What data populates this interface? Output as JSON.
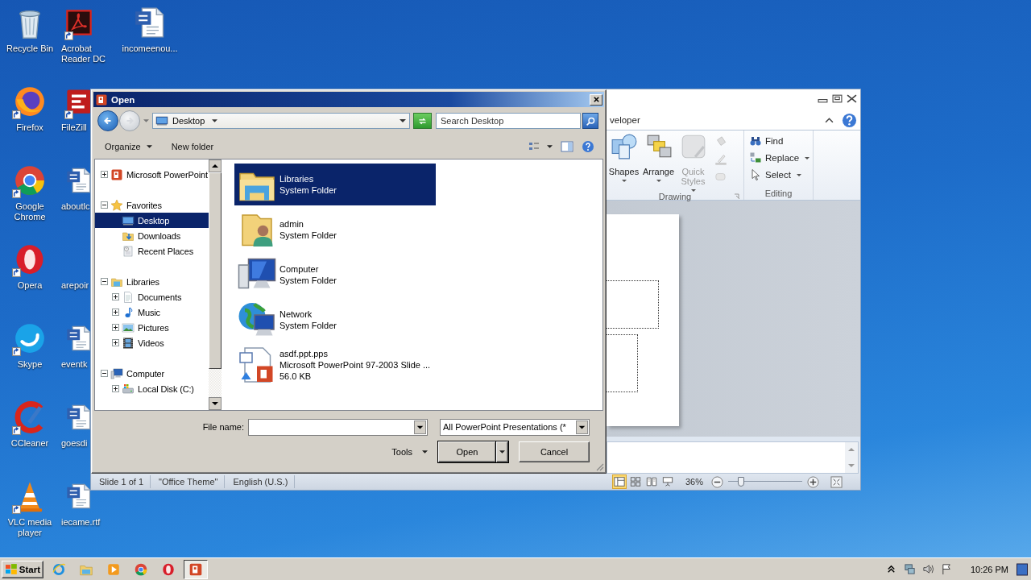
{
  "desktop": {
    "columns": [
      [
        {
          "label": "Recycle Bin",
          "kind": "recycle",
          "shortcut": false
        },
        {
          "label": "Firefox",
          "kind": "firefox",
          "shortcut": true
        },
        {
          "label": "Google Chrome",
          "kind": "chrome",
          "shortcut": true
        },
        {
          "label": "Opera",
          "kind": "opera",
          "shortcut": true
        },
        {
          "label": "Skype",
          "kind": "skype",
          "shortcut": true
        },
        {
          "label": "CCleaner",
          "kind": "ccleaner",
          "shortcut": true
        },
        {
          "label": "VLC media player",
          "kind": "vlc",
          "shortcut": true
        }
      ],
      [
        {
          "label": "Acrobat Reader DC",
          "kind": "acrobat",
          "shortcut": true
        },
        {
          "label": "FileZill",
          "kind": "filezilla",
          "shortcut": true
        },
        {
          "label": "aboutlc",
          "kind": "word",
          "shortcut": false
        },
        {
          "label": "arepoir",
          "kind": "blank",
          "shortcut": false
        },
        {
          "label": "eventk",
          "kind": "word",
          "shortcut": false
        },
        {
          "label": "goesdi",
          "kind": "word",
          "shortcut": false
        },
        {
          "label": "iecame.rtf",
          "kind": "word",
          "shortcut": false
        }
      ],
      [
        {
          "label": "incomeenou...",
          "kind": "word",
          "shortcut": false
        }
      ]
    ]
  },
  "powerpoint": {
    "ribbon_tab": "veloper",
    "drawing": {
      "label": "Drawing",
      "buttons": [
        {
          "label": "Shapes",
          "kind": "shapes",
          "disabled": false
        },
        {
          "label": "Arrange",
          "kind": "arrange",
          "disabled": false
        },
        {
          "label": "Quick Styles",
          "kind": "styles",
          "disabled": true
        }
      ]
    },
    "editing": {
      "label": "Editing",
      "items": [
        {
          "label": "Find",
          "kind": "find",
          "dropdown": false
        },
        {
          "label": "Replace",
          "kind": "replace",
          "dropdown": true
        },
        {
          "label": "Select",
          "kind": "select",
          "dropdown": true
        }
      ]
    },
    "status_bar": {
      "items": [
        "Slide 1 of 1",
        "\"Office Theme\"",
        "English (U.S.)"
      ],
      "views": [
        {
          "kind": "normal",
          "selected": true
        },
        {
          "kind": "sorter",
          "selected": false
        },
        {
          "kind": "reading",
          "selected": false
        },
        {
          "kind": "slideshow",
          "selected": false
        }
      ],
      "zoom": "36%",
      "zoom_slider": {
        "level": 0.17
      }
    }
  },
  "dialog": {
    "title": "Open",
    "address": "Desktop",
    "search": {
      "placeholder": "Search Desktop"
    },
    "organize": "Organize",
    "new_folder": "New folder",
    "tree": [
      {
        "label": "Microsoft PowerPoint",
        "kind": "ppt",
        "expanded": false,
        "selected": false
      },
      {
        "label": "Favorites",
        "kind": "star",
        "expanded": true,
        "selected": false,
        "children": [
          {
            "label": "Desktop",
            "kind": "desktop",
            "selected": true
          },
          {
            "label": "Downloads",
            "kind": "downloads",
            "selected": false
          },
          {
            "label": "Recent Places",
            "kind": "recent",
            "selected": false
          }
        ]
      },
      {
        "label": "Libraries",
        "kind": "libraries",
        "expanded": true,
        "selected": false,
        "children": [
          {
            "label": "Documents",
            "kind": "documents",
            "expanded": false,
            "selected": false
          },
          {
            "label": "Music",
            "kind": "music",
            "expanded": false,
            "selected": false
          },
          {
            "label": "Pictures",
            "kind": "pictures",
            "expanded": false,
            "selected": false
          },
          {
            "label": "Videos",
            "kind": "videos",
            "expanded": false,
            "selected": false
          }
        ]
      },
      {
        "label": "Computer",
        "kind": "computer",
        "expanded": true,
        "selected": false,
        "children": [
          {
            "label": "Local Disk (C:)",
            "kind": "disk",
            "expanded": false,
            "selected": false
          }
        ]
      }
    ],
    "files": [
      {
        "name": "Libraries",
        "details": [
          "System Folder"
        ],
        "kind": "libfolder",
        "selected": true
      },
      {
        "name": "admin",
        "details": [
          "System Folder"
        ],
        "kind": "admin",
        "selected": false
      },
      {
        "name": "Computer",
        "details": [
          "System Folder"
        ],
        "kind": "bigcomputer",
        "selected": false
      },
      {
        "name": "Network",
        "details": [
          "System Folder"
        ],
        "kind": "network",
        "selected": false
      },
      {
        "name": "asdf.ppt.pps",
        "details": [
          "Microsoft PowerPoint 97-2003 Slide ...",
          "56.0 KB"
        ],
        "kind": "pps",
        "selected": false
      }
    ],
    "file_name_label": "File name:",
    "filter": "All PowerPoint Presentations (*",
    "tools": "Tools",
    "open": "Open",
    "cancel": "Cancel"
  },
  "taskbar": {
    "start": "Start",
    "apps": [
      {
        "kind": "ie",
        "active": false
      },
      {
        "kind": "explorer",
        "active": false
      },
      {
        "kind": "media",
        "active": false
      },
      {
        "kind": "chrome",
        "active": false
      },
      {
        "kind": "opera",
        "active": false
      },
      {
        "kind": "ppt",
        "active": true
      }
    ],
    "clock": "10:26 PM"
  }
}
